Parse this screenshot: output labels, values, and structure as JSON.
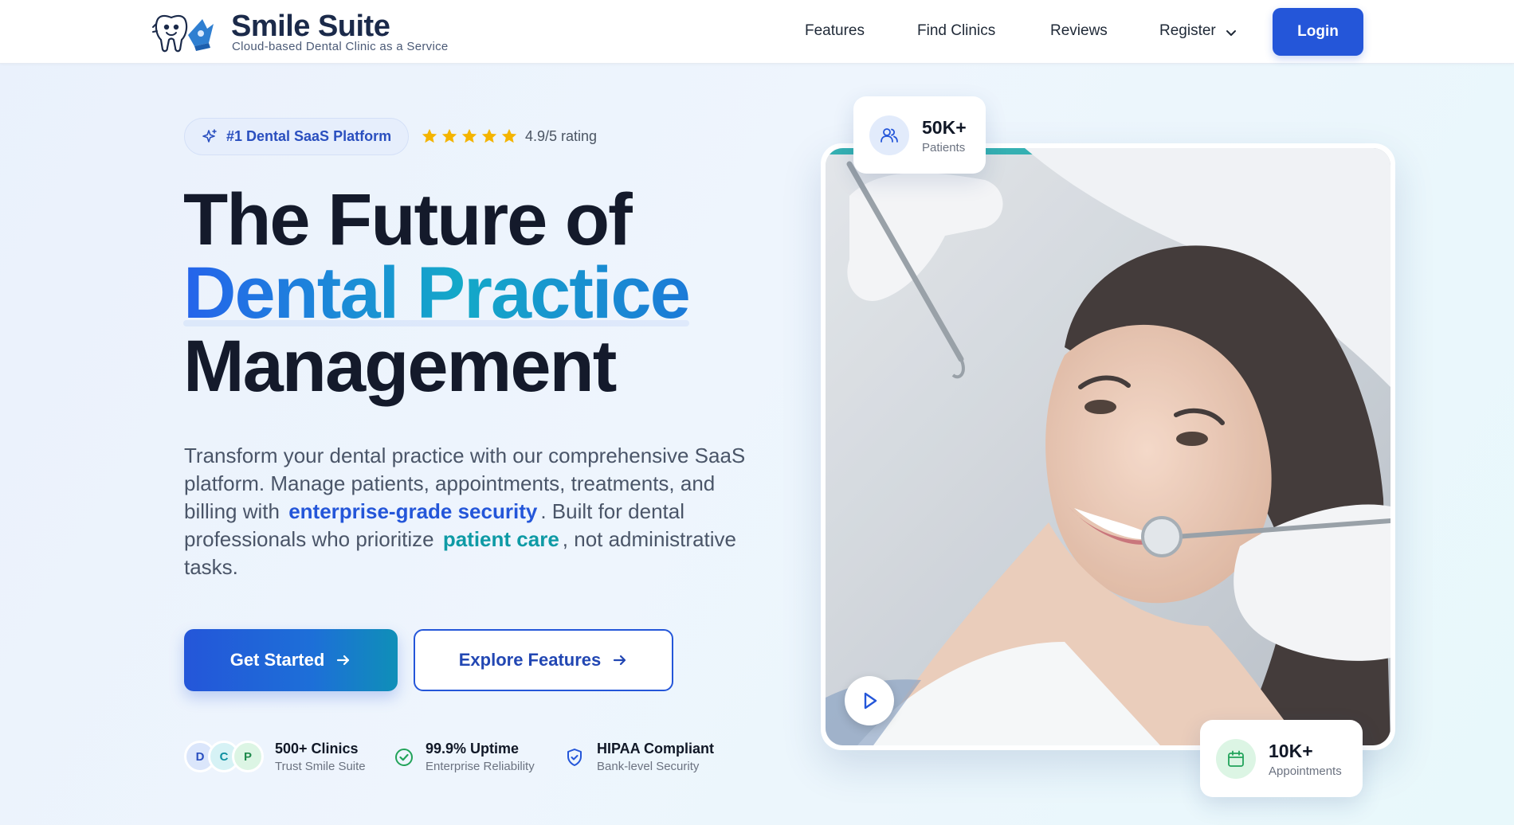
{
  "header": {
    "brand_name": "Smile Suite",
    "brand_tagline": "Cloud-based Dental Clinic as a Service",
    "nav": [
      {
        "label": "Features"
      },
      {
        "label": "Find Clinics"
      },
      {
        "label": "Reviews"
      },
      {
        "label": "Register"
      }
    ],
    "login_label": "Login"
  },
  "hero": {
    "badge_label": "#1 Dental SaaS Platform",
    "rating": {
      "stars": 5,
      "text": "4.9/5 rating"
    },
    "title_line1": "The Future of",
    "title_line2": "Dental Practice",
    "title_line3": "Management",
    "desc_part1": "Transform your dental practice with our comprehensive SaaS platform. Manage patients, appointments, treatments, and billing with",
    "desc_highlight1": "enterprise-grade security",
    "desc_part2": ". Built for dental professionals who prioritize",
    "desc_highlight2": "patient care",
    "desc_part3": ", not administrative tasks.",
    "primary_cta": "Get Started",
    "secondary_cta": "Explore Features"
  },
  "trust": {
    "avatars": [
      "D",
      "C",
      "P"
    ],
    "items": [
      {
        "title": "500+ Clinics",
        "subtitle": "Trust Smile Suite"
      },
      {
        "title": "99.9% Uptime",
        "subtitle": "Enterprise Reliability"
      },
      {
        "title": "HIPAA Compliant",
        "subtitle": "Bank-level Security"
      }
    ]
  },
  "stats": {
    "patients": {
      "value": "50K+",
      "label": "Patients",
      "icon": "users-icon"
    },
    "appointments": {
      "value": "10K+",
      "label": "Appointments",
      "icon": "calendar-icon"
    }
  },
  "colors": {
    "primary": "#2456d9",
    "teal": "#0e9aa5",
    "star": "#f4b400",
    "success": "#22a35a"
  }
}
